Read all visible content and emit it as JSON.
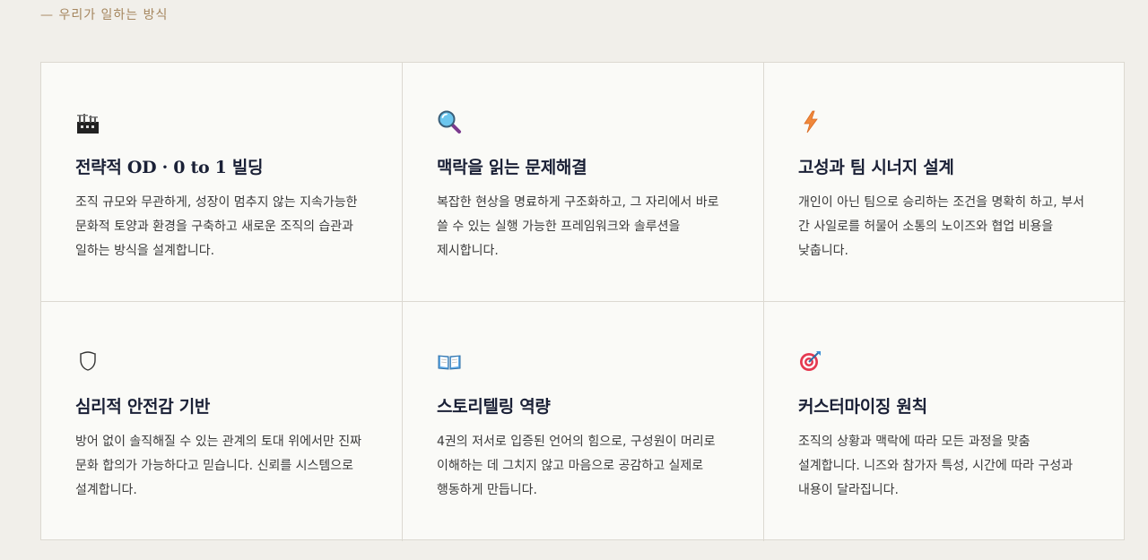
{
  "section": {
    "eyebrow": "— 우리가 일하는 방식"
  },
  "cards": [
    {
      "icon": "building-construction-icon",
      "title": "전략적 OD · 0 to 1 빌딩",
      "description": "조직 규모와 무관하게, 성장이 멈추지 않는 지속가능한 문화적 토양과 환경을 구축하고 새로운 조직의 습관과 일하는 방식을 설계합니다."
    },
    {
      "icon": "magnifying-glass-icon",
      "title": "맥락을 읽는 문제해결",
      "description": "복잡한 현상을 명료하게 구조화하고, 그 자리에서 바로 쓸 수 있는 실행 가능한 프레임워크와 솔루션을 제시합니다."
    },
    {
      "icon": "lightning-icon",
      "title": "고성과 팀 시너지 설계",
      "description": "개인이 아닌 팀으로 승리하는 조건을 명확히 하고, 부서 간 사일로를 허물어 소통의 노이즈와 협업 비용을 낮춥니다."
    },
    {
      "icon": "shield-icon",
      "title": "심리적 안전감 기반",
      "description": "방어 없이 솔직해질 수 있는 관계의 토대 위에서만 진짜 문화 합의가 가능하다고 믿습니다. 신뢰를 시스템으로 설계합니다."
    },
    {
      "icon": "open-book-icon",
      "title": "스토리텔링 역량",
      "description": "4권의 저서로 입증된 언어의 힘으로, 구성원이 머리로 이해하는 데 그치지 않고 마음으로 공감하고 실제로 행동하게 만듭니다."
    },
    {
      "icon": "target-dart-icon",
      "title": "커스터마이징 원칙",
      "description": "조직의 상황과 맥락에 따라 모든 과정을 맞춤 설계합니다. 니즈와 참가자 특성, 시간에 따라 구성과 내용이 달라집니다."
    }
  ]
}
